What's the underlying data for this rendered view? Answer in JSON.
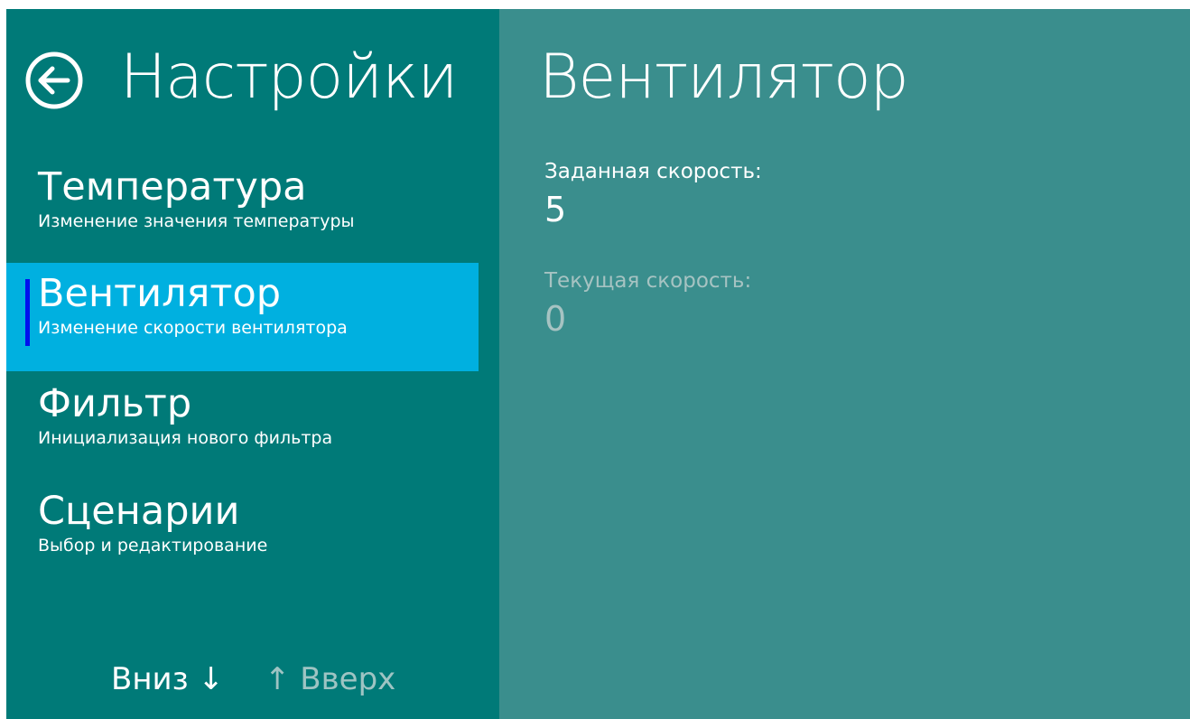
{
  "sidebar": {
    "title": "Настройки",
    "back_icon": "arrow-left-circle-icon",
    "items": [
      {
        "label": "Температура",
        "subtitle": "Изменение значения температуры",
        "selected": false
      },
      {
        "label": "Вентилятор",
        "subtitle": "Изменение скорости вентилятора",
        "selected": true
      },
      {
        "label": "Фильтр",
        "subtitle": "Инициализация нового фильтра",
        "selected": false
      },
      {
        "label": "Сценарии",
        "subtitle": "Выбор и редактирование",
        "selected": false
      }
    ],
    "nav": {
      "down": "Вниз ↓",
      "up": "↑ Вверх"
    }
  },
  "main": {
    "title": "Вентилятор",
    "target_speed": {
      "label": "Заданная скорость:",
      "value": "5"
    },
    "current_speed": {
      "label": "Текущая скорость:",
      "value": "0"
    }
  },
  "colors": {
    "sidebar_bg": "#007a78",
    "content_bg": "#3a8e8d",
    "selected_bg": "#00b0e0",
    "selection_bar": "#0011ee"
  }
}
